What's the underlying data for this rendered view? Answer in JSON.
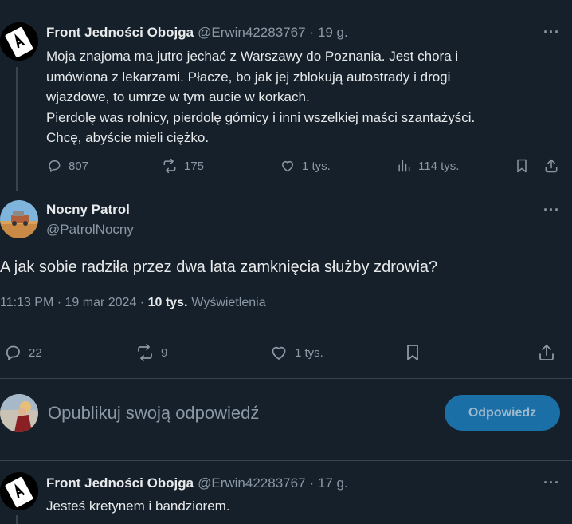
{
  "tweet1": {
    "name": "Front Jedności Obojga",
    "handle": "@Erwin42283767",
    "time": "· 19 g.",
    "text": "Moja znajoma ma jutro jechać z Warszawy do Poznania. Jest chora i\numówiona z lekarzami. Płacze, bo jak jej zblokują autostrady i drogi\nwjazdowe, to umrze w tym aucie w korkach.\nPierdolę was rolnicy, pierdolę górnicy i inni wszelkiej maści szantażyści.\nChcę, abyście mieli ciężko.",
    "replies": "807",
    "reposts": "175",
    "likes": "1 tys.",
    "views": "114 tys.",
    "more": "···"
  },
  "main_tweet": {
    "name": "Nocny Patrol",
    "handle": "@PatrolNocny",
    "text": "A jak sobie radziła przez dwa lata zamknięcia służby zdrowia?",
    "timestamp": "11:13 PM · 19 mar 2024 · ",
    "views_count": "10 tys.",
    "views_label": "Wyświetlenia",
    "replies": "22",
    "reposts": "9",
    "likes": "1 tys.",
    "more": "···"
  },
  "reply_box": {
    "placeholder": "Opublikuj swoją odpowiedź",
    "button": "Odpowiedz"
  },
  "tweet3": {
    "name": "Front Jedności Obojga",
    "handle": "@Erwin42283767",
    "time": "· 17 g.",
    "text": "Jesteś kretynem i bandziorem.",
    "more": "···"
  },
  "colors": {
    "background": "#15202b",
    "divider": "#38444d",
    "button": "#1d9bf0"
  }
}
